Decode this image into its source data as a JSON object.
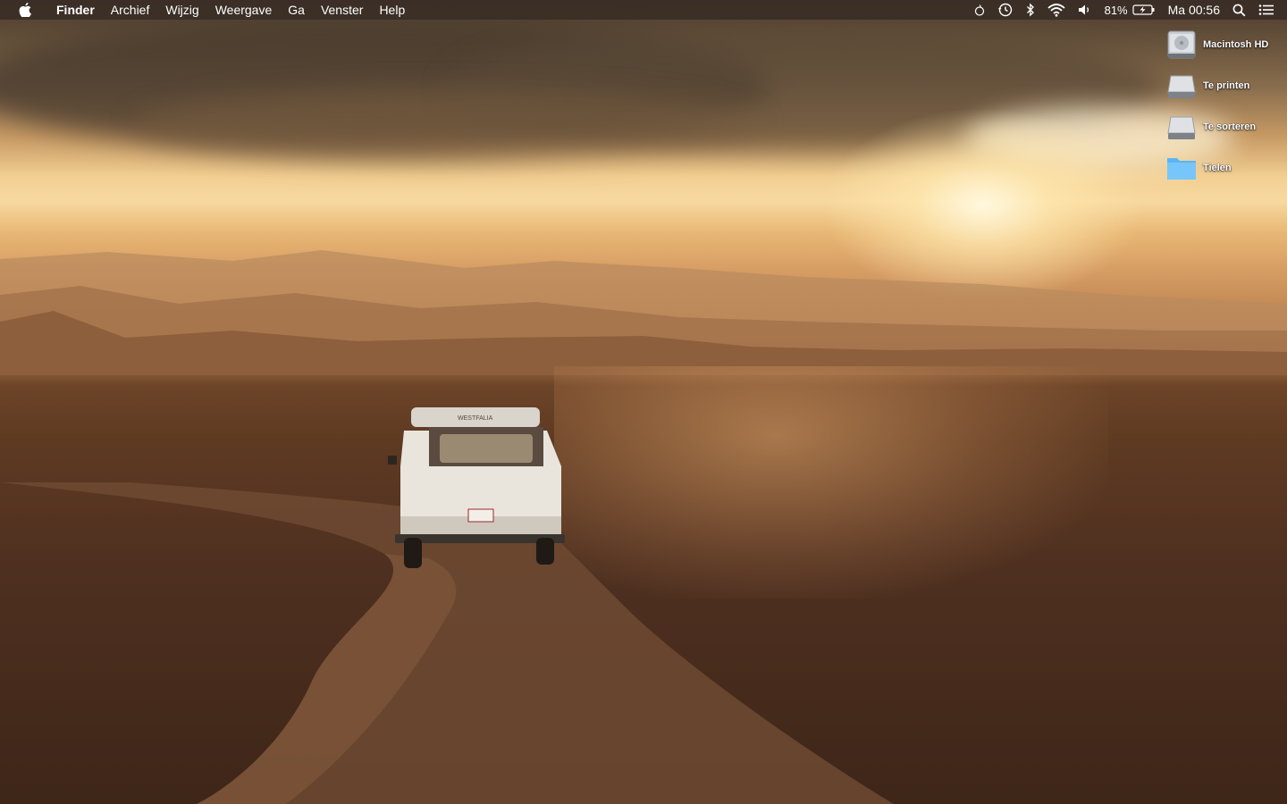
{
  "menubar": {
    "app_name": "Finder",
    "menus": [
      "Archief",
      "Wijzig",
      "Weergave",
      "Ga",
      "Venster",
      "Help"
    ],
    "status": {
      "icons": [
        "timer-icon",
        "time-machine-icon",
        "bluetooth-icon",
        "wifi-icon",
        "volume-icon"
      ],
      "battery_percent": "81%",
      "clock": "Ma 00:56",
      "right_icons": [
        "spotlight-search-icon",
        "notification-center-icon"
      ]
    }
  },
  "desktop": {
    "icons": [
      {
        "label": "Macintosh HD",
        "kind": "hard-drive"
      },
      {
        "label": "Te printen",
        "kind": "external-drive"
      },
      {
        "label": "Te sorteren",
        "kind": "external-drive"
      },
      {
        "label": "Tielen",
        "kind": "folder"
      }
    ]
  },
  "wallpaper": {
    "van_plate_text": "WESTFALIA"
  }
}
